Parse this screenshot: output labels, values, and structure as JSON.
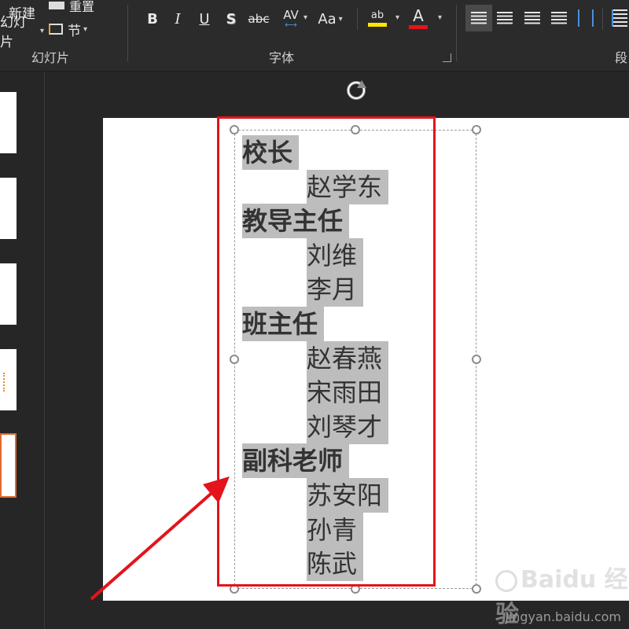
{
  "ribbon": {
    "new_slide_label_line1": "新建",
    "new_slide_label_line2": "幻灯片",
    "reset_label": "重置",
    "section_label": "节",
    "group_slides": "幻灯片",
    "group_font": "字体",
    "group_paragraph": "段",
    "bold": "B",
    "italic": "I",
    "underline": "U",
    "shadow": "S",
    "strikethrough": "abc",
    "char_spacing": "AV",
    "change_case": "Aa",
    "highlight": "ab",
    "font_color": "A"
  },
  "textbox": {
    "lines": [
      {
        "text": "校长",
        "bold": true
      },
      {
        "text": "赵学东",
        "bold": false
      },
      {
        "text": "教导主任",
        "bold": true
      },
      {
        "text": "刘维",
        "bold": false
      },
      {
        "text": "李月",
        "bold": false
      },
      {
        "text": "班主任",
        "bold": true
      },
      {
        "text": "赵春燕",
        "bold": false
      },
      {
        "text": "宋雨田",
        "bold": false
      },
      {
        "text": "刘琴才",
        "bold": false
      },
      {
        "text": "副科老师",
        "bold": true
      },
      {
        "text": "苏安阳",
        "bold": false
      },
      {
        "text": "孙青",
        "bold": false
      },
      {
        "text": "陈武",
        "bold": false
      }
    ]
  },
  "watermark": {
    "brand": "Baidu 经验",
    "url": "jingyan.baidu.com"
  },
  "colors": {
    "accent_red": "#e3141a",
    "highlight_yellow": "#ffe600",
    "font_color_red": "#e3141a",
    "selection_gray": "#bdbdbd"
  }
}
